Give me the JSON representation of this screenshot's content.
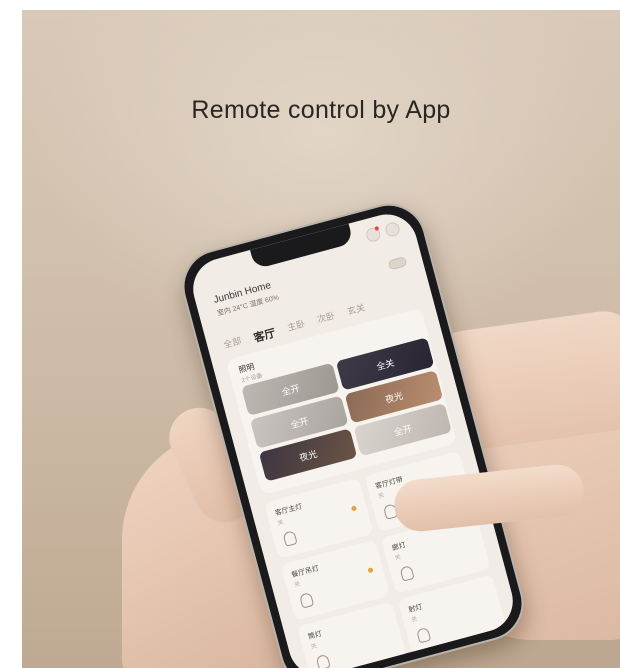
{
  "headline": "Remote control by App",
  "app": {
    "home_title": "Junbin Home",
    "home_sub": "室内 24°C 湿度 60%",
    "tabs": [
      "全部",
      "客厅",
      "主卧",
      "次卧",
      "玄关"
    ],
    "active_tab_index": 1,
    "scene_card": {
      "label": "照明",
      "sublabel": "2个设备",
      "tiles": [
        "全开",
        "全关",
        "全开",
        "夜光",
        "夜光",
        "全开"
      ]
    },
    "devices": [
      {
        "name": "客厅主灯",
        "status": "关",
        "on": true
      },
      {
        "name": "客厅灯带",
        "status": "关",
        "on": false
      },
      {
        "name": "餐厅吊灯",
        "status": "关",
        "on": true
      },
      {
        "name": "廊灯",
        "status": "关",
        "on": false
      },
      {
        "name": "筒灯",
        "status": "关",
        "on": false
      },
      {
        "name": "射灯",
        "status": "关",
        "on": false
      }
    ]
  },
  "colors": {
    "background": "#d8c9b8",
    "phone_frame": "#1a1a1c",
    "screen": "#f1ece5",
    "accent_dot": "#e8a23a"
  }
}
